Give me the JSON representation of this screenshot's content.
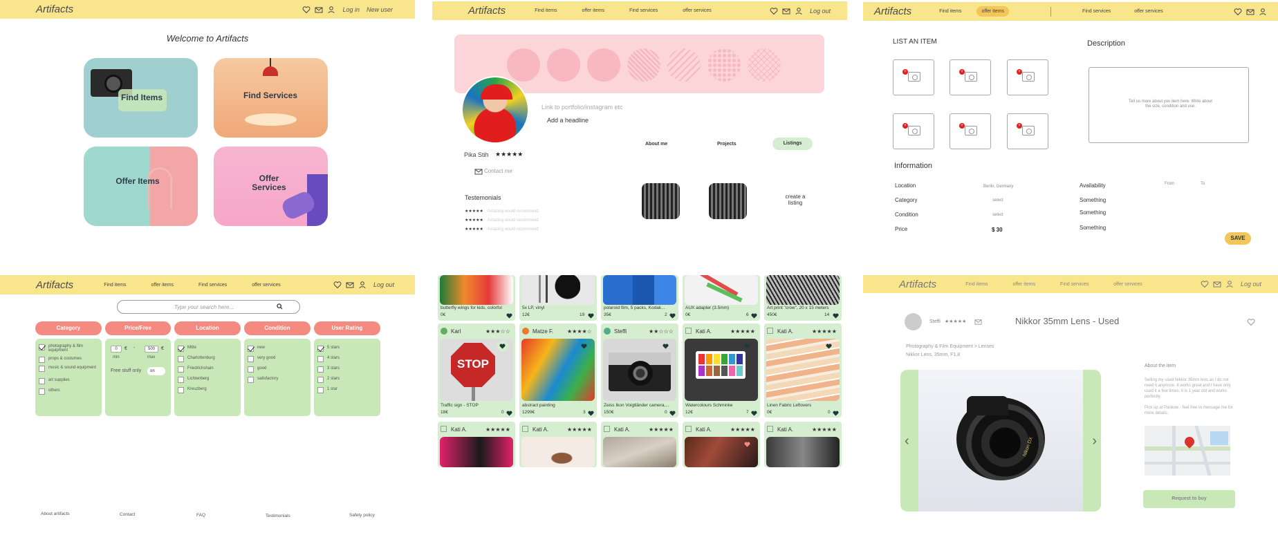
{
  "nav": {
    "logo": "Artifacts",
    "find_items": "Find items",
    "offer_items": "offer items",
    "find_services": "Find services",
    "offer_services": "offer services",
    "login": "Log in",
    "new_user": "New user",
    "logout": "Log out"
  },
  "panel1": {
    "welcome": "Welcome to Artifacts",
    "tiles": [
      "Find Items",
      "Find Services",
      "Offer Items",
      "Offer Services"
    ]
  },
  "panel2": {
    "link_placeholder": "Link to portfolio/instagram etc",
    "headline": "Add a headline",
    "name": "Pika Stih",
    "stars": "★★★★★",
    "contact": "Contact me",
    "tabs": [
      "About me",
      "Projects",
      "Listings"
    ],
    "testimonials": "Testemonials",
    "testimonial_rows": [
      "★★★★★",
      "★★★★★",
      "★★★★★"
    ],
    "testimonial_text": "Amazing would recommend",
    "create_listing": "create a listing"
  },
  "panel3": {
    "list_item": "LIST AN ITEM",
    "description": "Description",
    "desc_text": "Tell us more about you item here. Write about the size, condition and use.",
    "information": "Information",
    "rows": [
      {
        "label": "Location",
        "value": "Berlin, Germany"
      },
      {
        "label": "Category",
        "value": "select"
      },
      {
        "label": "Condition",
        "value": "select"
      },
      {
        "label": "Price",
        "value": "$ 30"
      }
    ],
    "right_rows": [
      {
        "label": "Availability",
        "from": "From",
        "to": "To"
      },
      {
        "label": "Something"
      },
      {
        "label": "Something"
      },
      {
        "label": "Something"
      }
    ],
    "save": "SAVE"
  },
  "panel4": {
    "search_placeholder": "Type your search here...",
    "pills": [
      "Category",
      "Price/Free",
      "Location",
      "Condition",
      "User Rating"
    ],
    "category": [
      "photography & film equipment",
      "props & costumes",
      "music & sound equipment",
      "art supplies",
      "others"
    ],
    "price": {
      "min": "0",
      "max": "500",
      "currency": "€",
      "min_label": "min",
      "max_label": "max",
      "free_label": "Free stuff only",
      "toggle": "on"
    },
    "location": [
      "Mitte",
      "Charlottenburg",
      "Friedrichshain",
      "Lichtenberg",
      "Kreuzberg"
    ],
    "condition": [
      "new",
      "very good",
      "good",
      "satisfactory"
    ],
    "rating": [
      "5 stars",
      "4 stars",
      "3 stars",
      "2 stars",
      "1 star"
    ],
    "footer": [
      "About artifacts",
      "Contact",
      "FAQ",
      "Testimonials",
      "Safety policy"
    ]
  },
  "panel5": {
    "row1": [
      {
        "title": "butterfly wings for kids, colorful",
        "price": "0€",
        "likes": ""
      },
      {
        "title": "5x LP, vinyl",
        "price": "12€",
        "likes": "19"
      },
      {
        "title": "polaroid film, 5 packs, Kodak...",
        "price": "35€",
        "likes": "2"
      },
      {
        "title": "AUX adapter (3.5mm)",
        "price": "0€",
        "likes": "6"
      },
      {
        "title": "Art print \"crow\", 20 x 15 meters",
        "price": "450€",
        "likes": "14"
      }
    ],
    "row2": [
      {
        "user": "Karl",
        "stars": "★★★☆☆",
        "title": "Traffic sign - STOP",
        "price": "18€",
        "likes": "0"
      },
      {
        "user": "Matze F.",
        "stars": "★★★★☆",
        "title": "abstract painting",
        "price": "1299€",
        "likes": "3"
      },
      {
        "user": "Steffi",
        "stars": "★★☆☆☆",
        "title": "Zeiss Ikon Voigtländer camera,...",
        "price": "150€",
        "likes": "0"
      },
      {
        "user": "Kati A.",
        "stars": "★★★★★",
        "title": "Watercolours Schminke",
        "price": "12€",
        "likes": "7"
      },
      {
        "user": "Kati A.",
        "stars": "★★★★★",
        "title": "Linen Fabric Leftovers",
        "price": "0€",
        "likes": "0"
      }
    ],
    "row3": [
      {
        "user": "Kati A.",
        "stars": "★★★★★"
      },
      {
        "user": "Kati A.",
        "stars": "★★★★★"
      },
      {
        "user": "Kati A.",
        "stars": "★★★★★"
      },
      {
        "user": "Kati A.",
        "stars": "★★★★★"
      },
      {
        "user": "Kati A.",
        "stars": "★★★★★"
      }
    ],
    "stop_text": "STOP"
  },
  "panel6": {
    "seller": "Steffi",
    "stars": "★★★★★",
    "title": "Nikkor 35mm Lens - Used",
    "breadcrumb": "Photography & Film Equipment > Lenses",
    "subtitle": "Nikkor Lens, 35mm, F1.8",
    "about_title": "About the item",
    "about_text": "Selling my used Nikkor 35mm lens as I do not need it anymore. It works great and I have only used it a few times, it is 1 year old and works perfectly.",
    "pickup": "Pick up at Pankow - feel free to message me for more details.",
    "request": "Request to buy",
    "lens_text": "Nikon DX"
  },
  "colors": {
    "nav": "#f9e58c",
    "accent": "#f48a80",
    "green": "#c8e8b8",
    "pink": "#fbd5d8"
  }
}
